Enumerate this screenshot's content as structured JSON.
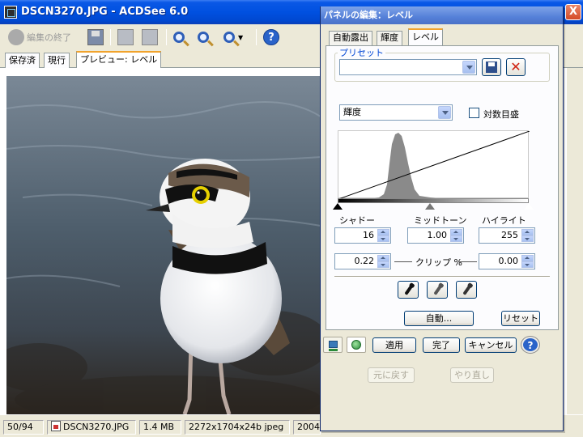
{
  "window": {
    "title": "DSCN3270.JPG - ACDSee 6.0",
    "close_label": "X"
  },
  "toolbar": {
    "finish_edit_label": "編集の終了",
    "help_label": "?"
  },
  "document_tabs": [
    {
      "label": "保存済"
    },
    {
      "label": "現行"
    },
    {
      "label": "プレビュー: レベル"
    }
  ],
  "statusbar": {
    "position": "50/94",
    "filename": "DSCN3270.JPG",
    "filesize": "1.4 MB",
    "dimensions": "2272x1704x24b jpeg",
    "date_fragment": "2004"
  },
  "panel": {
    "title": "パネルの編集：レベル",
    "tabs": [
      {
        "label": "自動露出"
      },
      {
        "label": "輝度"
      },
      {
        "label": "レベル"
      }
    ],
    "preset_group_label": "プリセット",
    "preset_value": "",
    "channel_value": "輝度",
    "log_scale_label": "対数目盛",
    "log_scale_checked": false,
    "shadow_label": "シャドー",
    "midtone_label": "ミッドトーン",
    "highlight_label": "ハイライト",
    "shadow_value": "16",
    "midtone_value": "1.00",
    "highlight_value": "255",
    "clip_label": "クリップ %",
    "clip_left_value": "0.22",
    "clip_right_value": "0.00",
    "auto_button_label": "自動...",
    "reset_button_label": "リセット",
    "apply_button_label": "適用",
    "done_button_label": "完了",
    "cancel_button_label": "キャンセル",
    "help_label": "?",
    "undo_button_label": "元に戻す",
    "redo_button_label": "やり直し",
    "preset_delete_label": "✕"
  }
}
